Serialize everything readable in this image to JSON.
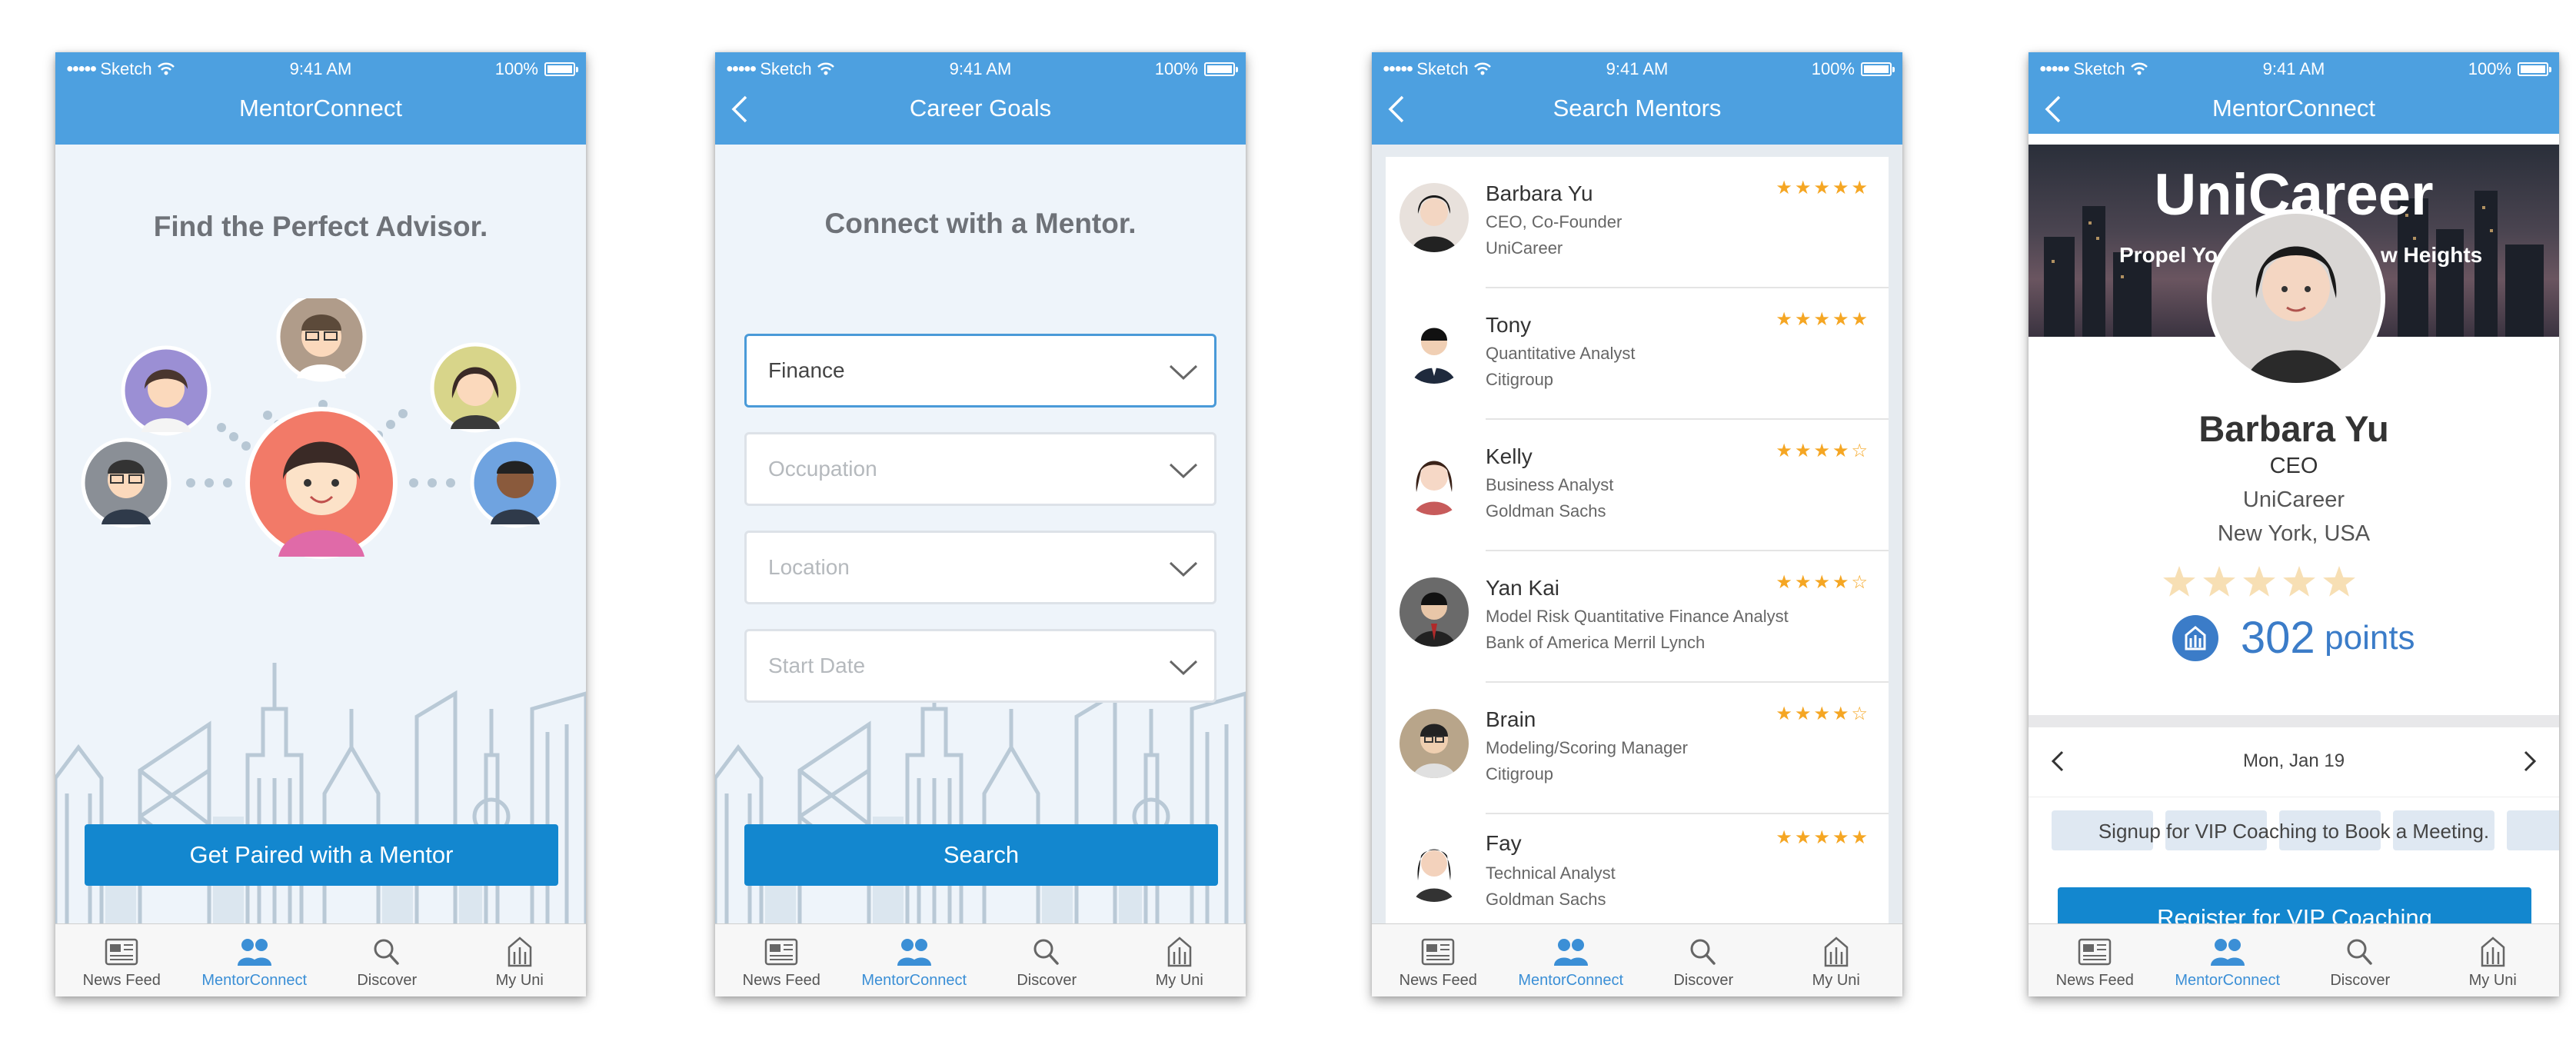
{
  "status": {
    "carrier": "Sketch",
    "time": "9:41 AM",
    "battery": "100%"
  },
  "tabs": [
    "News Feed",
    "MentorConnect",
    "Discover",
    "My Uni"
  ],
  "screen1": {
    "title": "MentorConnect",
    "headline": "Find the Perfect Advisor.",
    "cta": "Get Paired with a Mentor"
  },
  "screen2": {
    "title": "Career Goals",
    "headline": "Connect with a Mentor.",
    "fields": [
      "Finance",
      "Occupation",
      "Location",
      "Start Date"
    ],
    "cta": "Search"
  },
  "screen3": {
    "title": "Search Mentors",
    "mentors": [
      {
        "name": "Barbara Yu",
        "role": "CEO, Co-Founder",
        "company": "UniCareer",
        "stars": "★★★★★"
      },
      {
        "name": "Tony",
        "role": "Quantitative Analyst",
        "company": "Citigroup",
        "stars": "★★★★★"
      },
      {
        "name": "Kelly",
        "role": "Business Analyst",
        "company": "Goldman Sachs",
        "stars": "★★★★☆"
      },
      {
        "name": "Yan Kai",
        "role": "Model Risk Quantitative Finance Analyst",
        "company": "Bank of America Merril Lynch",
        "stars": "★★★★☆"
      },
      {
        "name": "Brain",
        "role": "Modeling/Scoring Manager",
        "company": "Citigroup",
        "stars": "★★★★☆"
      },
      {
        "name": "Fay",
        "role": "Technical Analyst",
        "company": "Goldman Sachs",
        "stars": "★★★★★"
      }
    ]
  },
  "screen4": {
    "title": "MentorConnect",
    "banner_title": "UniCareer",
    "banner_sub_left": "Propel Yo",
    "banner_sub_right": "w Heights",
    "name": "Barbara Yu",
    "role": "CEO",
    "company": "UniCareer",
    "location": "New York, USA",
    "rating": 5,
    "points_value": "302",
    "points_label": "points",
    "date": "Mon, Jan 19",
    "vip_message": "Signup for VIP Coaching to Book a Meeting.",
    "register_cta": "Register for VIP Coaching"
  },
  "colors": {
    "accent": "#4da0e0",
    "button": "#1387cf",
    "star": "#f5a623"
  }
}
